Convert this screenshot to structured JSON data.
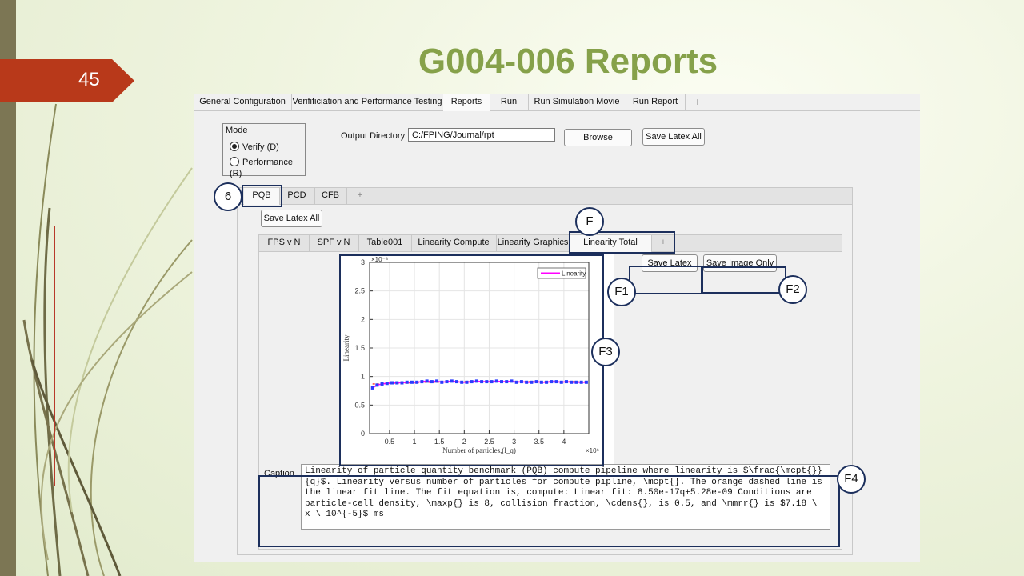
{
  "slide": {
    "number": "45",
    "title": "G004-006 Reports"
  },
  "app": {
    "top_tabs": [
      "General Configuration",
      "Verifificiation and Performance Testing",
      "Reports",
      "Run",
      "Run Simulation Movie",
      "Run Report"
    ],
    "add_tab": "+",
    "mode": {
      "title": "Mode",
      "options": [
        "Verify (D)",
        "Performance (R)"
      ],
      "selected": "Verify (D)"
    },
    "output_dir_label": "Output Directory",
    "output_dir_value": "C:/FPING/Journal/rpt",
    "browse_label": "Browse",
    "save_latex_all_label": "Save Latex All",
    "sub_tabs": [
      "PQB",
      "PCD",
      "CFB"
    ],
    "sub_save_latex_all_label": "Save Latex All",
    "report_tabs": [
      "FPS v N",
      "SPF v N",
      "Table001",
      "Linearity Compute",
      "Linearity Graphics",
      "Linearity Total"
    ],
    "save_latex_label": "Save Latex",
    "save_image_only_label": "Save Image Only",
    "caption_label": "Caption",
    "caption_text": "Linearity of particle quantity benchmark (PQB) compute pipeline where linearity is $\\frac{\\mcpt{}}{q}$. Linearity versus number of particles for compute pipline, \\mcpt{}. The orange dashed line is the linear fit line. The fit equation is, compute: Linear fit: 8.50e-17q+5.28e-09 Conditions are particle-cell density, \\maxp{} is 8, collision fraction, \\cdens{}, is 0.5, and \\mmrr{} is $7.18 \\ x \\ 10^{-5}$ ms"
  },
  "callouts": [
    "6",
    "F",
    "F1",
    "F2",
    "F3",
    "F4"
  ],
  "colors": {
    "accent_title": "#86a14a",
    "slide_number_bg": "#b8391a",
    "callout_border": "#1c2f5c",
    "series": "#ff00ff",
    "markers": "#2a3bff",
    "fit_line": "#ff3030"
  },
  "chart_data": {
    "type": "line",
    "y_exponent_label": "×10⁻⁸",
    "x_exponent_label": "×10⁶",
    "xlabel": "Number of particles,(l_q)",
    "ylabel": "Linearity",
    "xlim": [
      0.1,
      4.5
    ],
    "ylim": [
      0,
      3
    ],
    "x_ticks": [
      "0.5",
      "1",
      "1.5",
      "2",
      "2.5",
      "3",
      "3.5",
      "4"
    ],
    "y_ticks": [
      "0",
      "0.5",
      "1",
      "1.5",
      "2",
      "2.5",
      "3"
    ],
    "grid": true,
    "legend_position": "top-right",
    "series": [
      {
        "name": "Linearity",
        "x": [
          0.16,
          0.25,
          0.35,
          0.45,
          0.55,
          0.65,
          0.75,
          0.85,
          0.95,
          1.05,
          1.15,
          1.25,
          1.35,
          1.45,
          1.55,
          1.65,
          1.75,
          1.85,
          1.95,
          2.05,
          2.15,
          2.25,
          2.35,
          2.45,
          2.55,
          2.65,
          2.75,
          2.85,
          2.95,
          3.05,
          3.15,
          3.25,
          3.35,
          3.45,
          3.55,
          3.65,
          3.75,
          3.85,
          3.95,
          4.05,
          4.15,
          4.25,
          4.35,
          4.45
        ],
        "y": [
          0.8,
          0.85,
          0.87,
          0.88,
          0.89,
          0.89,
          0.89,
          0.9,
          0.9,
          0.9,
          0.91,
          0.92,
          0.91,
          0.92,
          0.9,
          0.91,
          0.92,
          0.91,
          0.9,
          0.9,
          0.91,
          0.92,
          0.91,
          0.91,
          0.91,
          0.92,
          0.91,
          0.91,
          0.92,
          0.9,
          0.91,
          0.9,
          0.9,
          0.91,
          0.9,
          0.9,
          0.91,
          0.91,
          0.9,
          0.91,
          0.9,
          0.9,
          0.9,
          0.9
        ]
      },
      {
        "fit_y": [
          0.87,
          0.87,
          0.87,
          0.88,
          0.88,
          0.88,
          0.89,
          0.89,
          0.89,
          0.89,
          0.9,
          0.9,
          0.9,
          0.9,
          0.9,
          0.91,
          0.91,
          0.91,
          0.91,
          0.91,
          0.91,
          0.91,
          0.91,
          0.91,
          0.91,
          0.91,
          0.91,
          0.91,
          0.91,
          0.91,
          0.91,
          0.91,
          0.91,
          0.91,
          0.91,
          0.91,
          0.91,
          0.91,
          0.91,
          0.91,
          0.91,
          0.91,
          0.91,
          0.91
        ]
      }
    ]
  }
}
